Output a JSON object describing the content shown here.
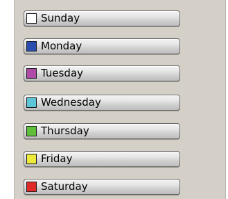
{
  "days": [
    {
      "label": "Sunday",
      "color": "#ffffff"
    },
    {
      "label": "Monday",
      "color": "#2a4fb0"
    },
    {
      "label": "Tuesday",
      "color": "#b04aa8"
    },
    {
      "label": "Wednesday",
      "color": "#5cc6d6"
    },
    {
      "label": "Thursday",
      "color": "#5fbf3a"
    },
    {
      "label": "Friday",
      "color": "#eeea3a"
    },
    {
      "label": "Saturday",
      "color": "#e02a2a"
    }
  ]
}
